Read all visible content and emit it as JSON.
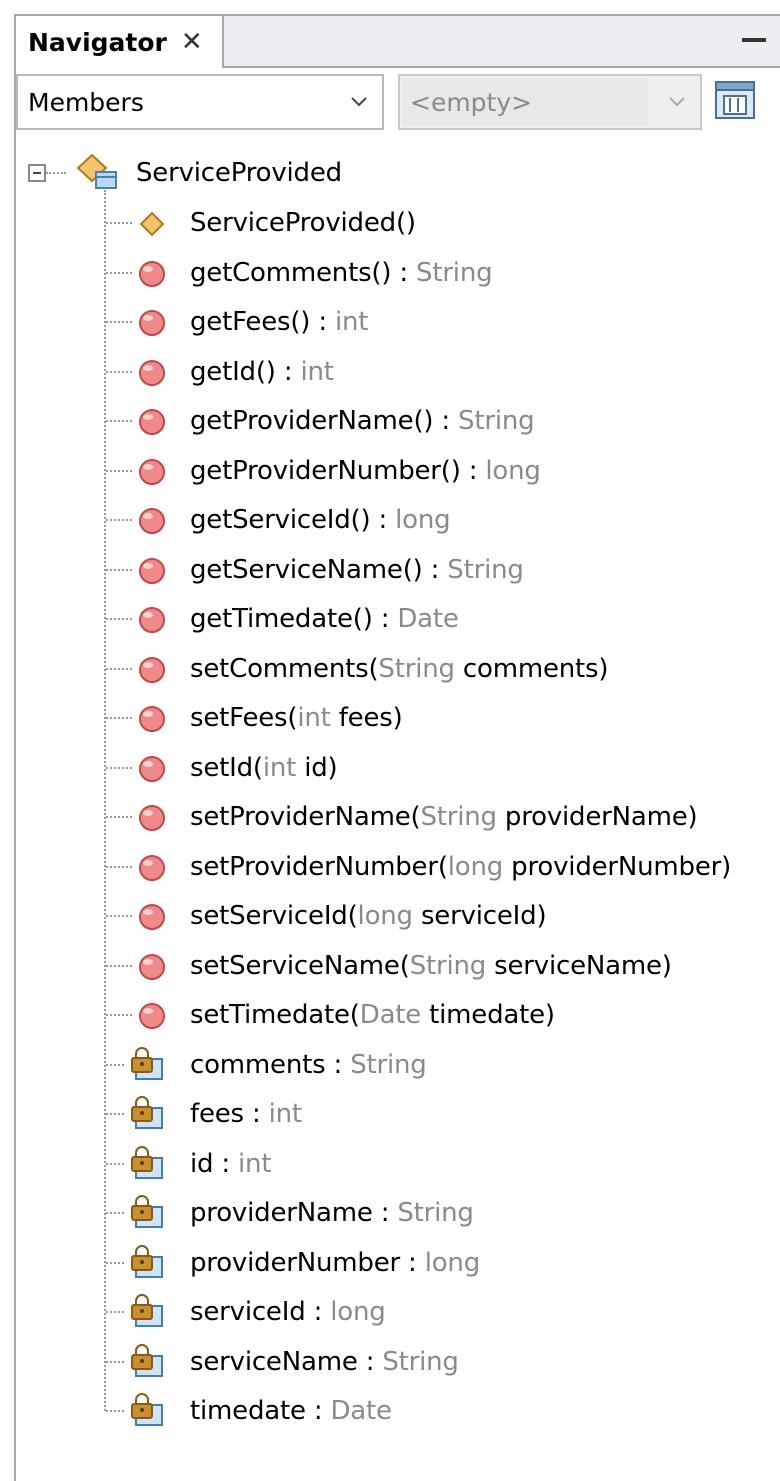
{
  "tab": {
    "title": "Navigator",
    "close_glyph": "✕"
  },
  "filter": {
    "members": "Members",
    "empty_placeholder": "<empty>"
  },
  "root": {
    "name": "ServiceProvided"
  },
  "members": [
    {
      "kind": "constructor",
      "parts": [
        [
          "ServiceProvided()",
          "b"
        ]
      ]
    },
    {
      "kind": "method",
      "parts": [
        [
          "getComments()",
          "b"
        ],
        [
          " : ",
          "b"
        ],
        [
          "String",
          "g"
        ]
      ]
    },
    {
      "kind": "method",
      "parts": [
        [
          "getFees()",
          "b"
        ],
        [
          " : ",
          "b"
        ],
        [
          "int",
          "g"
        ]
      ]
    },
    {
      "kind": "method",
      "parts": [
        [
          "getId()",
          "b"
        ],
        [
          " : ",
          "b"
        ],
        [
          "int",
          "g"
        ]
      ]
    },
    {
      "kind": "method",
      "parts": [
        [
          "getProviderName()",
          "b"
        ],
        [
          " : ",
          "b"
        ],
        [
          "String",
          "g"
        ]
      ]
    },
    {
      "kind": "method",
      "parts": [
        [
          "getProviderNumber()",
          "b"
        ],
        [
          " : ",
          "b"
        ],
        [
          "long",
          "g"
        ]
      ]
    },
    {
      "kind": "method",
      "parts": [
        [
          "getServiceId()",
          "b"
        ],
        [
          " : ",
          "b"
        ],
        [
          "long",
          "g"
        ]
      ]
    },
    {
      "kind": "method",
      "parts": [
        [
          "getServiceName()",
          "b"
        ],
        [
          " : ",
          "b"
        ],
        [
          "String",
          "g"
        ]
      ]
    },
    {
      "kind": "method",
      "parts": [
        [
          "getTimedate()",
          "b"
        ],
        [
          " : ",
          "b"
        ],
        [
          "Date",
          "g"
        ]
      ]
    },
    {
      "kind": "method",
      "parts": [
        [
          "setComments(",
          "b"
        ],
        [
          "String",
          "g"
        ],
        [
          " comments)",
          "b"
        ]
      ]
    },
    {
      "kind": "method",
      "parts": [
        [
          "setFees(",
          "b"
        ],
        [
          "int",
          "g"
        ],
        [
          " fees)",
          "b"
        ]
      ]
    },
    {
      "kind": "method",
      "parts": [
        [
          "setId(",
          "b"
        ],
        [
          "int",
          "g"
        ],
        [
          " id)",
          "b"
        ]
      ]
    },
    {
      "kind": "method",
      "parts": [
        [
          "setProviderName(",
          "b"
        ],
        [
          "String",
          "g"
        ],
        [
          " providerName)",
          "b"
        ]
      ]
    },
    {
      "kind": "method",
      "parts": [
        [
          "setProviderNumber(",
          "b"
        ],
        [
          "long",
          "g"
        ],
        [
          " providerNumber)",
          "b"
        ]
      ]
    },
    {
      "kind": "method",
      "parts": [
        [
          "setServiceId(",
          "b"
        ],
        [
          "long",
          "g"
        ],
        [
          " serviceId)",
          "b"
        ]
      ]
    },
    {
      "kind": "method",
      "parts": [
        [
          "setServiceName(",
          "b"
        ],
        [
          "String",
          "g"
        ],
        [
          " serviceName)",
          "b"
        ]
      ]
    },
    {
      "kind": "method",
      "parts": [
        [
          "setTimedate(",
          "b"
        ],
        [
          "Date",
          "g"
        ],
        [
          " timedate)",
          "b"
        ]
      ]
    },
    {
      "kind": "field",
      "parts": [
        [
          "comments",
          "b"
        ],
        [
          " : ",
          "b"
        ],
        [
          "String",
          "g"
        ]
      ]
    },
    {
      "kind": "field",
      "parts": [
        [
          "fees",
          "b"
        ],
        [
          " : ",
          "b"
        ],
        [
          "int",
          "g"
        ]
      ]
    },
    {
      "kind": "field",
      "parts": [
        [
          "id",
          "b"
        ],
        [
          " : ",
          "b"
        ],
        [
          "int",
          "g"
        ]
      ]
    },
    {
      "kind": "field",
      "parts": [
        [
          "providerName",
          "b"
        ],
        [
          " : ",
          "b"
        ],
        [
          "String",
          "g"
        ]
      ]
    },
    {
      "kind": "field",
      "parts": [
        [
          "providerNumber",
          "b"
        ],
        [
          " : ",
          "b"
        ],
        [
          "long",
          "g"
        ]
      ]
    },
    {
      "kind": "field",
      "parts": [
        [
          "serviceId",
          "b"
        ],
        [
          " : ",
          "b"
        ],
        [
          "long",
          "g"
        ]
      ]
    },
    {
      "kind": "field",
      "parts": [
        [
          "serviceName",
          "b"
        ],
        [
          " : ",
          "b"
        ],
        [
          "String",
          "g"
        ]
      ]
    },
    {
      "kind": "field",
      "parts": [
        [
          "timedate",
          "b"
        ],
        [
          " : ",
          "b"
        ],
        [
          "Date",
          "g"
        ]
      ]
    }
  ],
  "icons": {
    "class": "class-icon",
    "constructor": "constructor-diamond-icon",
    "method": "private-method-icon",
    "field": "private-field-lock-icon"
  },
  "colors": {
    "method": "#f08a8a",
    "constructor": "#f3c46a",
    "field": "#6ab0e0",
    "lock": "#c8902e"
  }
}
